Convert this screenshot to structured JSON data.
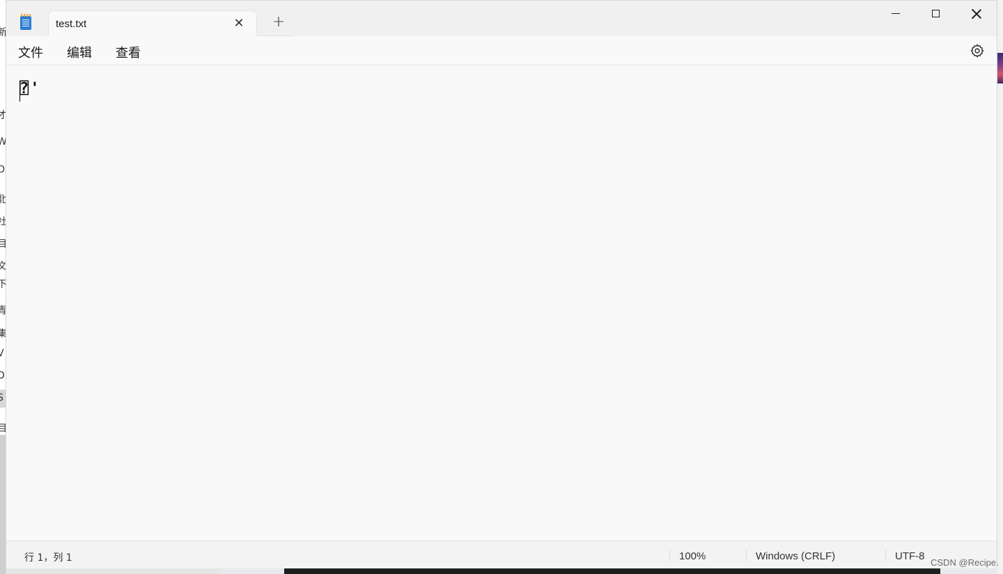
{
  "background": {
    "left_chars": [
      "新",
      "才",
      "W",
      "O",
      "北",
      "社",
      "目",
      "文",
      "下",
      "青",
      "集",
      "V",
      "D",
      "S",
      "目"
    ]
  },
  "window": {
    "tab_title": "test.txt",
    "tab_close_glyph": "✕",
    "tab_add_glyph": "+",
    "controls": {
      "minimize": "minimize",
      "maximize": "maximize",
      "close": "close"
    }
  },
  "menu": {
    "file": "文件",
    "edit": "编辑",
    "view": "查看"
  },
  "editor": {
    "content": "⍰'"
  },
  "status": {
    "position": "行 1，列 1",
    "zoom": "100%",
    "line_ending": "Windows (CRLF)",
    "encoding": "UTF-8"
  },
  "watermark": "CSDN @Recipe."
}
